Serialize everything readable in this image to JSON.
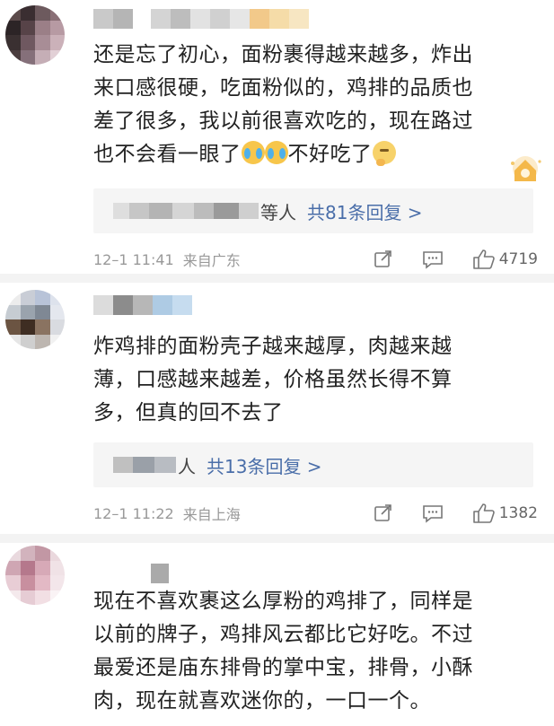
{
  "comments": [
    {
      "text_parts": [
        "还是忘了初心，面粉裹得越来越多，炸出\n来口感很硬，吃面粉似的，鸡排的品质也\n差了很多，我以前很喜欢吃的，现在路过\n也不会看一眼了",
        "不好吃了"
      ],
      "emoji_names": [
        "loudly-crying-emoji",
        "loudly-crying-emoji",
        "thinking-emoji"
      ],
      "replies": {
        "who": "等人",
        "count": "共81条回复 >"
      },
      "time": "12–1 11:41",
      "location": "来自广东",
      "likes": "4719"
    },
    {
      "text": "炸鸡排的面粉壳子越来越厚，肉越来越\n薄，口感越来越差，价格虽然长得不算\n多，但真的回不去了",
      "replies": {
        "who": "人",
        "count": "共13条回复 >"
      },
      "time": "12–1 11:22",
      "location": "来自上海",
      "likes": "1382"
    },
    {
      "text": "现在不喜欢裹这么厚粉的鸡排了，同样是\n以前的牌子，鸡排风云都比它好吃。不过\n最爱还是庙东排骨的掌中宝，排骨，小酥\n肉，现在就喜欢迷你的，一口一个。"
    }
  ],
  "icons": {
    "share": "share-icon",
    "comment": "comment-icon",
    "like": "thumbs-up-icon",
    "badge": "fan-badge-icon"
  },
  "colors": {
    "link": "#4a6ea9",
    "meta": "#999999",
    "reply_bg": "#f5f5f5"
  }
}
